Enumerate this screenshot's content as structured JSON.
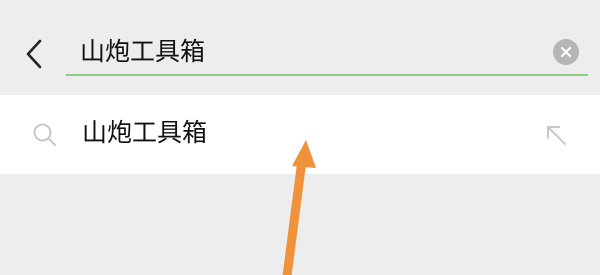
{
  "search": {
    "query": "山炮工具箱"
  },
  "suggestions": [
    {
      "label": "山炮工具箱"
    }
  ],
  "icons": {
    "back": "chevron-left-icon",
    "clear": "clear-icon",
    "search": "search-icon",
    "fill": "arrow-up-left-icon"
  },
  "colors": {
    "accent_underline": "#8fc783",
    "annotation_arrow": "#f0923a"
  }
}
